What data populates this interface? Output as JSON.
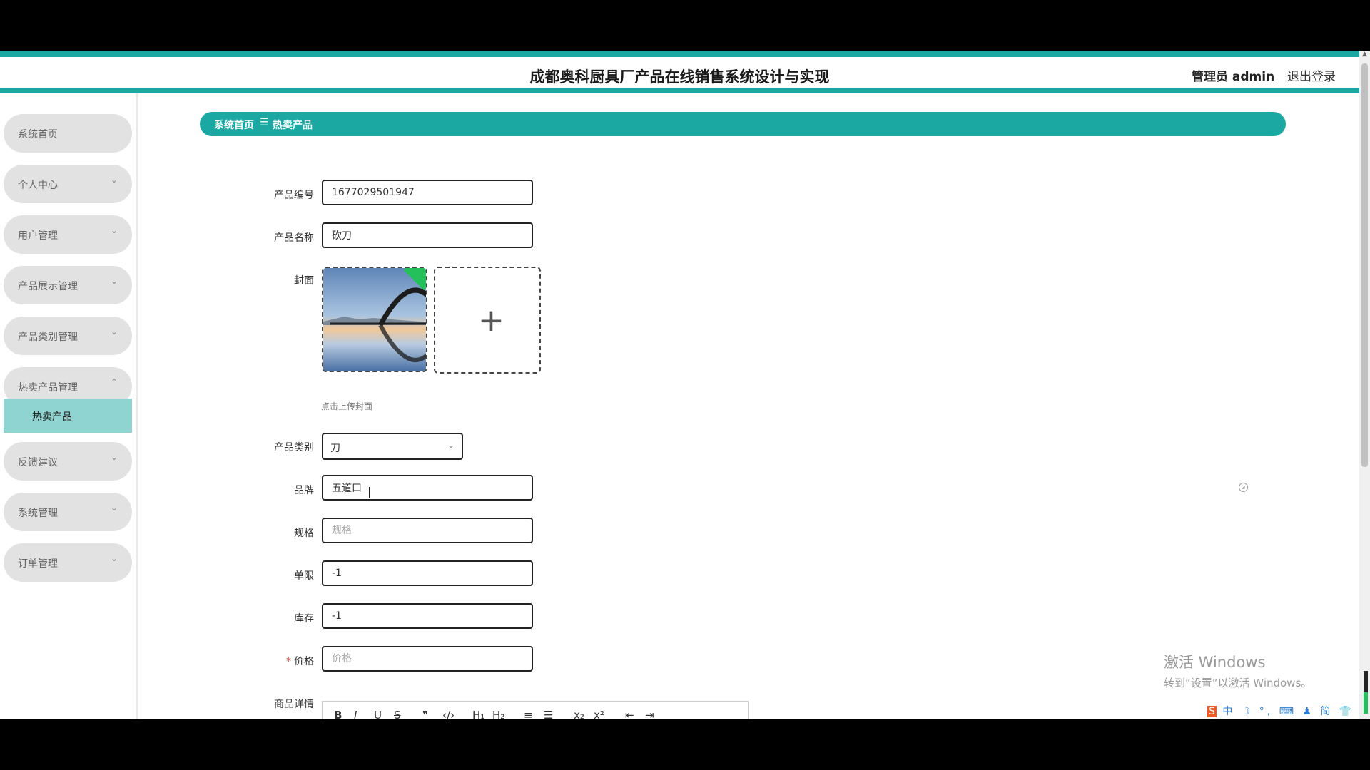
{
  "header": {
    "title": "成都奥科厨具厂产品在线销售系统设计与实现",
    "admin": "管理员 admin",
    "logout": "退出登录"
  },
  "sidebar": {
    "items": [
      {
        "label": "系统首页",
        "chevron": ""
      },
      {
        "label": "个人中心",
        "chevron": "⌄"
      },
      {
        "label": "用户管理",
        "chevron": "⌄"
      },
      {
        "label": "产品展示管理",
        "chevron": "⌄"
      },
      {
        "label": "产品类别管理",
        "chevron": "⌄"
      },
      {
        "label": "热卖产品管理",
        "chevron": "⌃"
      },
      {
        "label": "反馈建议",
        "chevron": "⌄"
      },
      {
        "label": "系统管理",
        "chevron": "⌄"
      },
      {
        "label": "订单管理",
        "chevron": "⌄"
      }
    ],
    "active_sub": "热卖产品"
  },
  "breadcrumb": {
    "home": "系统首页",
    "separator": "☰",
    "current": "热卖产品"
  },
  "form": {
    "code": {
      "label": "产品编号",
      "value": "1677029501947"
    },
    "name": {
      "label": "产品名称",
      "value": "砍刀"
    },
    "cover": {
      "label": "封面",
      "hint": "点击上传封面",
      "add": "+"
    },
    "category": {
      "label": "产品类别",
      "value": "刀",
      "arrow": "⌄"
    },
    "brand": {
      "label": "品牌",
      "value": "五道口"
    },
    "spec": {
      "label": "规格",
      "placeholder": "规格",
      "value": ""
    },
    "limit": {
      "label": "单限",
      "value": "-1"
    },
    "stock": {
      "label": "库存",
      "value": "-1"
    },
    "price": {
      "label": "价格",
      "required": "*",
      "placeholder": "价格",
      "value": ""
    },
    "detail": {
      "label": "商品详情"
    }
  },
  "editor_toolbar": [
    "B",
    "I",
    "U",
    "S",
    "❞",
    "‹/›",
    "H₁",
    "H₂",
    "≡",
    "☰",
    "x₂",
    "x²",
    "⇤",
    "⇥"
  ],
  "watermark": {
    "line1": "激活 Windows",
    "line2": "转到“设置”以激活 Windows。"
  },
  "ime": {
    "logo": "S",
    "items": "中 ☽ °, ⌨ ♟ 简 👕 ⚙"
  },
  "colors": {
    "accent": "#1ba8a3",
    "active_sub": "#8fd4d0",
    "required": "#e74c3c"
  }
}
